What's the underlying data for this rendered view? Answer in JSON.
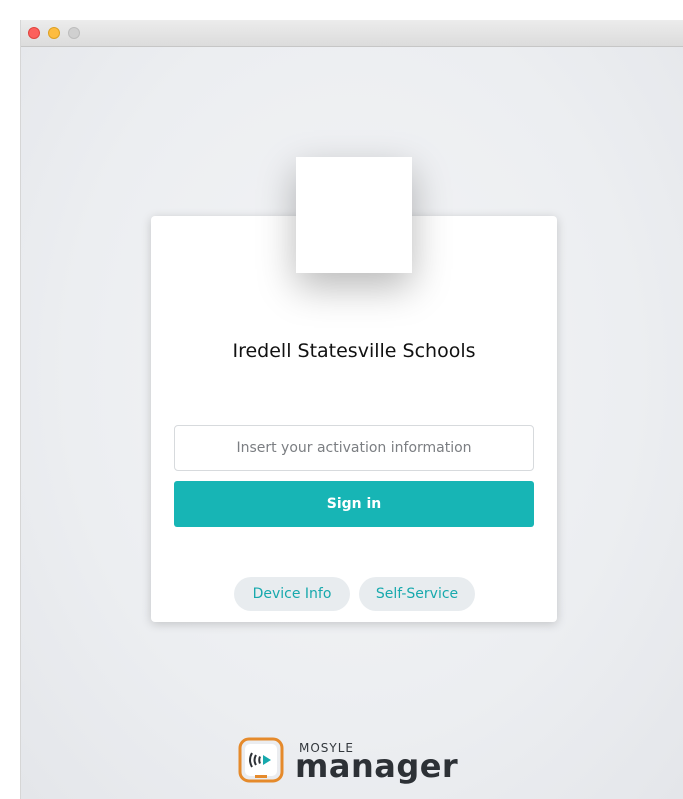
{
  "window": {
    "controls": [
      "close",
      "minimize",
      "zoom"
    ]
  },
  "login": {
    "organization": "Iredell Statesville Schools",
    "activation_placeholder": "Insert your activation information",
    "activation_value": "",
    "signin_label": "Sign in",
    "device_info_label": "Device Info",
    "self_service_label": "Self-Service"
  },
  "brand": {
    "small": "MOSYLE",
    "big": "manager",
    "icon": "mosyle-manager-icon"
  },
  "colors": {
    "accent": "#17b5b5",
    "pill_text": "#17a9ad",
    "brand_orange": "#e58a2b"
  }
}
